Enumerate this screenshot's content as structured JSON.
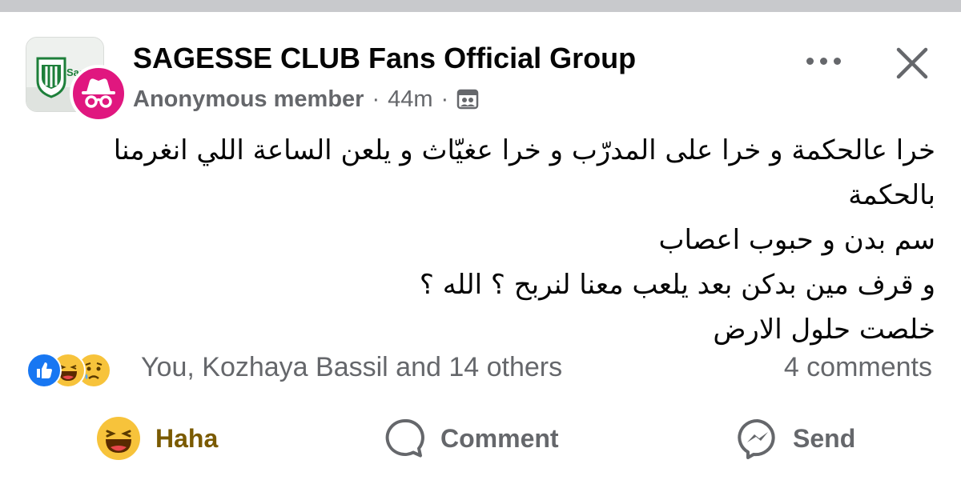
{
  "header": {
    "group_name": "SAGESSE CLUB Fans Official Group",
    "author": "Anonymous member",
    "separator": "·",
    "time": "44m",
    "group_logo_text": "Sag",
    "icons": {
      "anonymous": "incognito-icon",
      "audience": "group-audience-icon",
      "more": "more-options-icon",
      "close": "close-icon"
    }
  },
  "post": {
    "lines": [
      "خرا عالحكمة و خرا على المدرّب و خرا عغيّاث و يلعن الساعة اللي انغرمنا بالحكمة",
      "سم بدن و حبوب اعصاب",
      "و قرف مين بدكن بعد يلعب معنا لنربح ؟ الله ؟",
      "خلصت حلول الارض"
    ]
  },
  "reactions": {
    "icons": [
      "like-reaction-icon",
      "haha-reaction-icon",
      "sad-reaction-icon"
    ],
    "summary": "You, Kozhaya Bassil and 14 others",
    "comments": "4 comments"
  },
  "actions": {
    "react_label": "Haha",
    "comment_label": "Comment",
    "send_label": "Send"
  },
  "colors": {
    "anon_badge": "#e0177f",
    "like_blue": "#1877f2",
    "haha_text": "#7a5a00",
    "secondary_text": "#65676b"
  }
}
